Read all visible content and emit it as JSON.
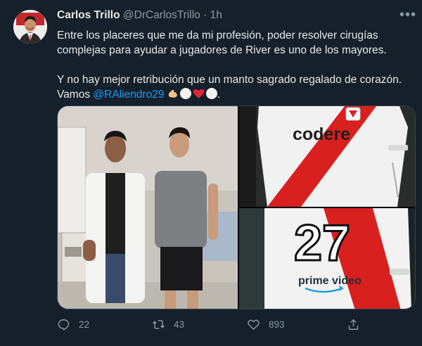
{
  "author": {
    "name": "Carlos Trillo",
    "handle": "@DrCarlosTrillo",
    "separator": "·",
    "time": "1h"
  },
  "menu_label": "•••",
  "tweet": {
    "line1": "Entre los placeres que me da mi profesión, poder resolver cirugías",
    "line2": "complejas para ayudar a jugadores de River es uno de los mayores.",
    "line3": "Y no hay mejor retribución que un manto sagrado regalado de corazón.",
    "line4_prefix": "Vamos ",
    "mention": "@RAliendro29",
    "line4_suffix": "."
  },
  "media": {
    "photo_main": "two-men-in-clinic-photo",
    "photo_top_right": {
      "sponsor": "codere",
      "icon": "river-plate-jersey-front"
    },
    "photo_bottom_right": {
      "number": "27",
      "sponsor": "prime video",
      "icon": "river-plate-jersey-back"
    }
  },
  "actions": {
    "replies": "22",
    "retweets": "43",
    "likes": "893"
  },
  "colors": {
    "background": "#15202b",
    "text": "#e7e9ea",
    "muted": "#8b98a5",
    "link": "#1d9bf0",
    "border": "#38444d"
  }
}
